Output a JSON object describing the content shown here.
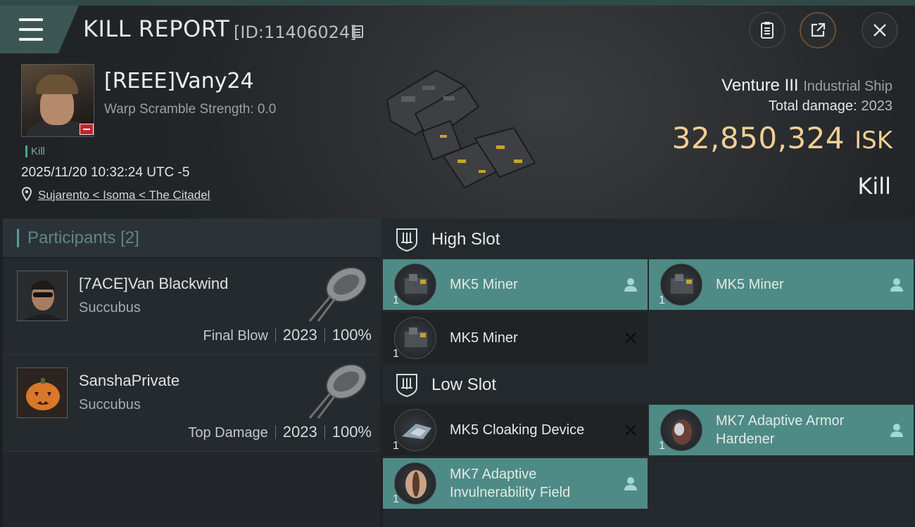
{
  "header": {
    "title": "KILL REPORT",
    "report_id": "[ID:11406024]"
  },
  "victim": {
    "name": "[REEE]Vany24",
    "warp_scramble": "Warp Scramble Strength: 0.0",
    "tag": "Kill",
    "timestamp": "2025/11/20 10:32:24 UTC -5",
    "location": "Sujarento < Isoma < The Citadel"
  },
  "ship_info": {
    "name": "Venture III",
    "class": "Industrial Ship",
    "total_damage_label": "Total damage:",
    "total_damage": "2023",
    "isk_value": "32,850,324",
    "isk_unit": "ISK",
    "result": "Kill"
  },
  "participants": {
    "label": "Participants",
    "count": "[2]",
    "items": [
      {
        "name": "[7ACE]Van Blackwind",
        "ship": "Succubus",
        "role": "Final Blow",
        "damage": "2023",
        "percent": "100%"
      },
      {
        "name": "SanshaPrivate",
        "ship": "Succubus",
        "role": "Top Damage",
        "damage": "2023",
        "percent": "100%"
      }
    ]
  },
  "slots": {
    "high": {
      "label": "High Slot",
      "modules": [
        {
          "name": "MK5 Miner",
          "qty": "1",
          "state": "person-icon"
        },
        {
          "name": "MK5 Miner",
          "qty": "1",
          "state": "person-icon"
        },
        {
          "name": "MK5 Miner",
          "qty": "1",
          "state": "destroyed-x-icon"
        }
      ]
    },
    "low": {
      "label": "Low Slot",
      "modules": [
        {
          "name": "MK5 Cloaking Device",
          "qty": "1",
          "state": "destroyed-x-icon"
        },
        {
          "name": "MK7 Adaptive Armor Hardener",
          "qty": "1",
          "state": "person-icon"
        },
        {
          "name": "MK7 Adaptive Invulnerability Field",
          "qty": "1",
          "state": "person-icon"
        }
      ]
    }
  },
  "colors": {
    "accent": "#4e8b86",
    "isk": "#f2cf94",
    "destroyed_badge": "#c0262a"
  }
}
